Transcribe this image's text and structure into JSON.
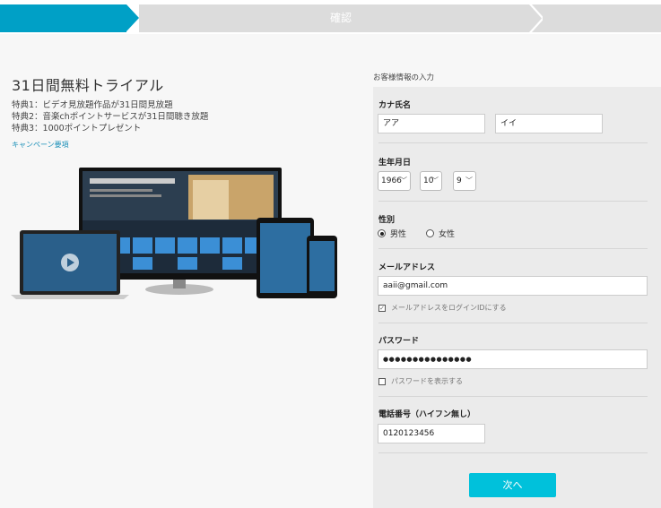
{
  "progress": {
    "step_current_label": "確認"
  },
  "promo": {
    "title": "31日間無料トライアル",
    "benefits": [
      "特典1：ビデオ見放題作品が31日間見放題",
      "特典2：音楽chポイントサービスが31日間聴き放題",
      "特典3：1000ポイントプレゼント"
    ],
    "campaign_link": "キャンペーン要項"
  },
  "form": {
    "caption": "お客様情報の入力",
    "kana_label": "カナ氏名",
    "kana_last_value": "アア",
    "kana_first_value": "イイ",
    "birth_label": "生年月日",
    "birth_year": "1966",
    "birth_month": "10",
    "birth_day": "9",
    "gender_label": "性別",
    "gender_male": "男性",
    "gender_female": "女性",
    "email_label": "メールアドレス",
    "email_value": "aaii@gmail.com",
    "email_login_checkbox": "メールアドレスをログインIDにする",
    "email_login_checked": true,
    "password_label": "パスワード",
    "password_value": "●●●●●●●●●●●●●●●",
    "password_show_checkbox": "パスワードを表示する",
    "phone_label": "電話番号（ハイフン無し）",
    "phone_value": "0120123456",
    "next_button": "次へ"
  },
  "colors": {
    "accent": "#00a0c6",
    "button": "#00c1db"
  }
}
